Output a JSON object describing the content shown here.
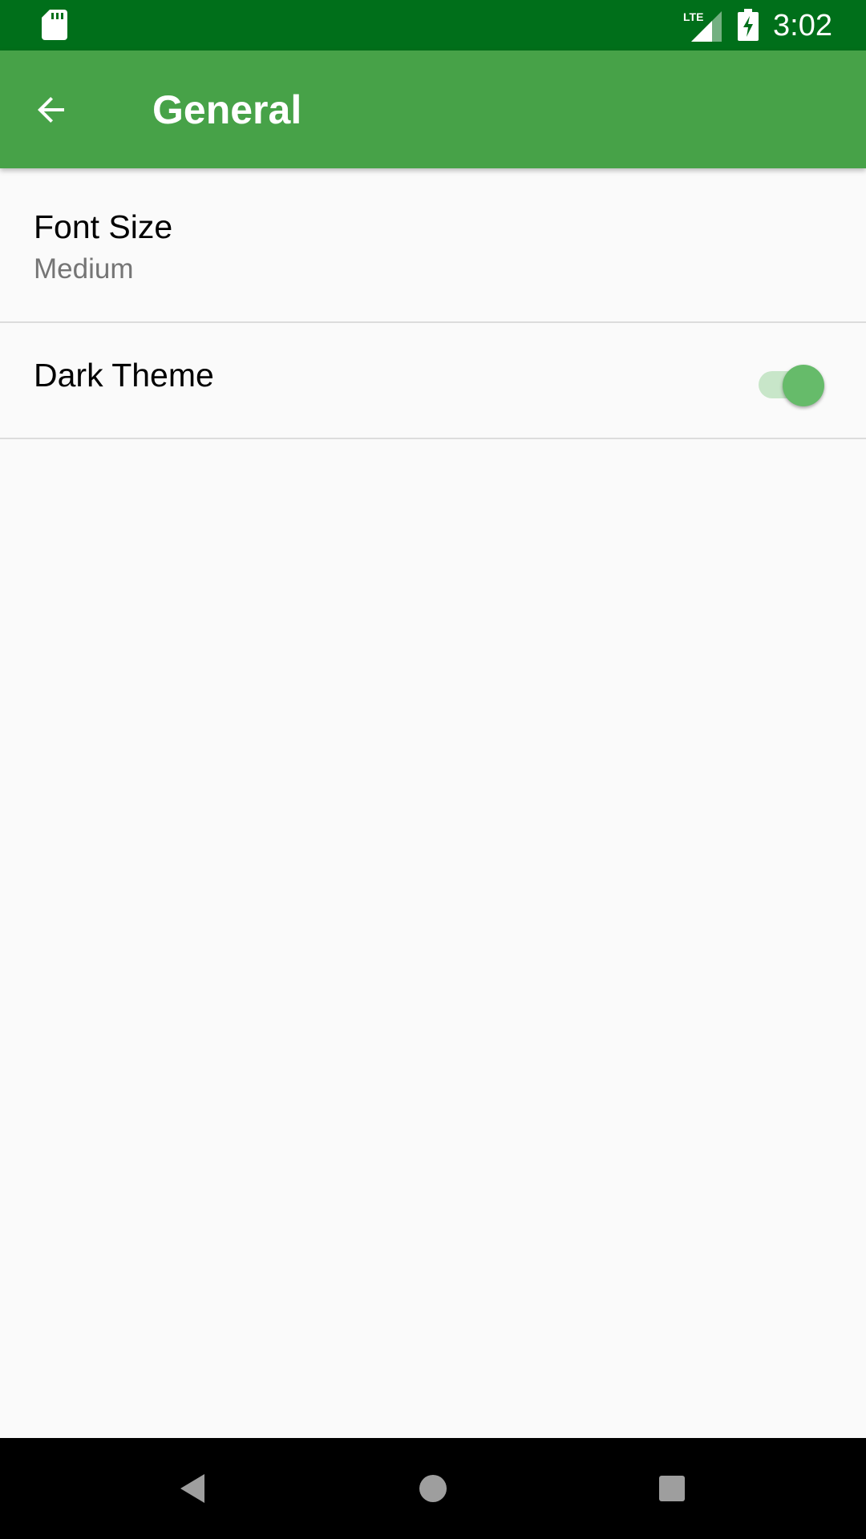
{
  "status_bar": {
    "time": "3:02",
    "network_label": "LTE",
    "icons": [
      "sd-card-icon",
      "lte-signal-icon",
      "battery-charging-icon"
    ]
  },
  "app_bar": {
    "title": "General",
    "back_icon": "arrow-back-icon"
  },
  "preferences": {
    "font_size": {
      "title": "Font Size",
      "summary": "Medium"
    },
    "dark_theme": {
      "title": "Dark Theme",
      "enabled": true
    }
  },
  "nav_bar": {
    "icons": [
      "nav-back-icon",
      "nav-home-icon",
      "nav-recents-icon"
    ]
  },
  "colors": {
    "status_bar": "#006f1a",
    "app_bar": "#47a248",
    "background": "#fafafa",
    "switch_thumb": "#66bb6a",
    "switch_track": "#c8e6c9",
    "divider": "#dcdcdc",
    "summary_text": "#757575"
  }
}
